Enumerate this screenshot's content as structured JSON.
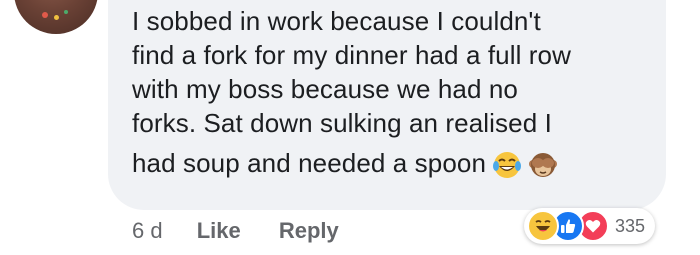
{
  "comment": {
    "lines": [
      "I sobbed in work because I couldn't",
      "find a fork for my dinner had a full row",
      "with my boss because we had no",
      "forks. Sat down sulking an realised I",
      "had soup and needed a spoon"
    ],
    "inline_emojis": [
      "tears-of-joy-emoji",
      "see-no-evil-monkey-emoji"
    ]
  },
  "actions": {
    "time": "6 d",
    "like_label": "Like",
    "reply_label": "Reply"
  },
  "reactions": {
    "icons": [
      "haha-reaction-icon",
      "like-reaction-icon",
      "love-reaction-icon"
    ],
    "count": "335"
  },
  "colors": {
    "bubble_bg": "#f0f2f5",
    "text": "#1c1e21",
    "meta_text": "#65676b",
    "like_blue": "#1877f2",
    "love_red": "#f33e58",
    "haha_yellow": "#f7c53e"
  }
}
